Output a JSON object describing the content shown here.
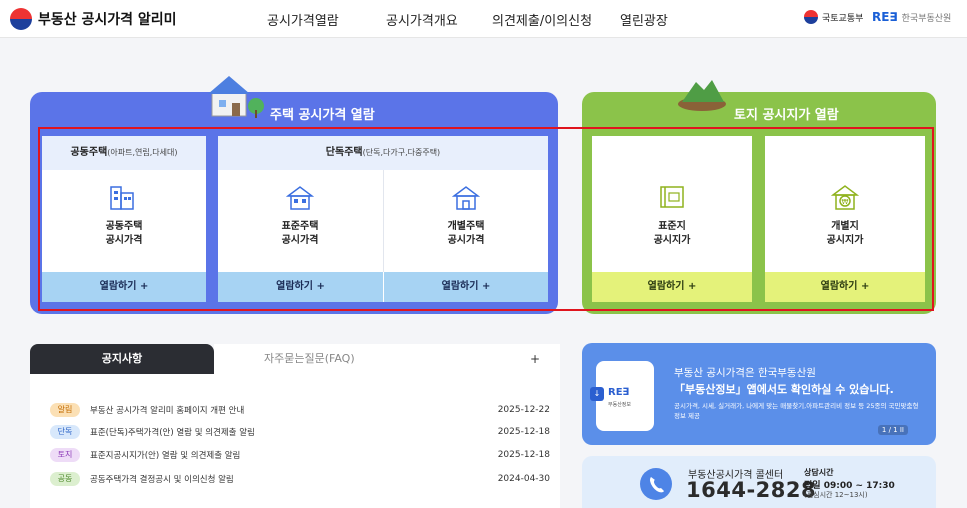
{
  "header": {
    "logo_text": "부동산 공시가격",
    "logo_bold": "알리미",
    "nav": [
      "공시가격열람",
      "공시가격개요",
      "의견제출/이의신청",
      "열린광장"
    ],
    "ministry": "국토교통부",
    "reb_mark": "RE∃",
    "reb_name": "한국부동산원"
  },
  "housing": {
    "title": "주택 공시가격 열람",
    "group1_head": "공동주택",
    "group1_sub": "(아파트,연립,다세대)",
    "group2_head": "단독주택",
    "group2_sub": "(단독,다가구,다중주택)",
    "items": [
      {
        "line1": "공동주택",
        "line2": "공시가격",
        "action": "열람하기 +"
      },
      {
        "line1": "표준주택",
        "line2": "공시가격",
        "action": "열람하기 +"
      },
      {
        "line1": "개별주택",
        "line2": "공시가격",
        "action": "열람하기 +"
      }
    ]
  },
  "land": {
    "title": "토지 공시지가 열람",
    "items": [
      {
        "line1": "표준지",
        "line2": "공시지가",
        "action": "열람하기 +"
      },
      {
        "line1": "개별지",
        "line2": "공시지가",
        "action": "열람하기 +"
      }
    ]
  },
  "notice": {
    "tab_active": "공지사항",
    "tab_idle": "자주묻는질문(FAQ)",
    "more": "+",
    "rows": [
      {
        "badge": "알림",
        "color": "#fbe0b5",
        "text": "부동산 공시가격 알리미 홈페이지 개편 안내",
        "date": "2025-12-22"
      },
      {
        "badge": "단독",
        "color": "#d8e8fb",
        "text": "표준(단독)주택가격(안) 열람 및 의견제출 알림",
        "date": "2025-12-18"
      },
      {
        "badge": "토지",
        "color": "#eedcf7",
        "text": "표준지공시지가(안) 열람 및 의견제출 알림",
        "date": "2025-12-18"
      },
      {
        "badge": "공동",
        "color": "#dcefcf",
        "text": "공동주택가격 결정공시 및 이의신청 알림",
        "date": "2024-04-30"
      }
    ]
  },
  "promo": {
    "line1": "부동산 공시가격은 한국부동산원",
    "line2": "「부동산정보」앱에서도 확인하실 수 있습니다.",
    "line3": "공시가격, 시세, 실거래가, 나에게 맞는 매물찾기,아파트관리비 정보 등 25종의 국민맞춤형 정보 제공",
    "page": "1 / 1  II",
    "app_mark": "RE∃",
    "app_label": "부동산정보"
  },
  "call": {
    "label": "부동산공시가격 콜센터",
    "number": "1644-2828",
    "hours_label": "상담시간",
    "hours": "평일 09:00 ~ 17:30",
    "hours_sub": "(점심시간 12~13시)"
  },
  "colors": {
    "housing_panel": "#5b74e8",
    "land_panel": "#8bc34a",
    "highlight": "#e0141e"
  }
}
